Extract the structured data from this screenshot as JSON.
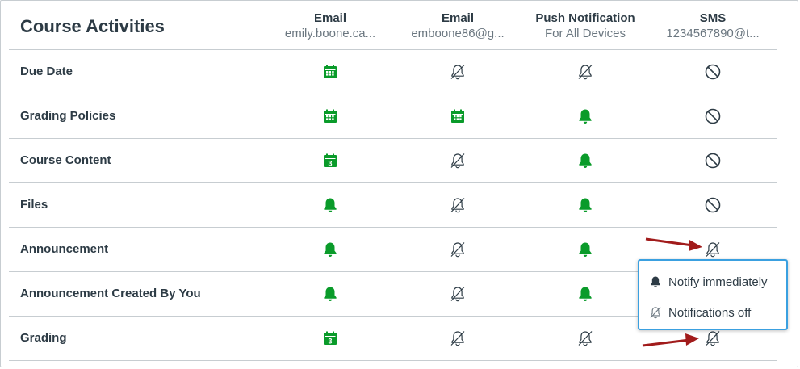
{
  "page": {
    "title": "Course Activities"
  },
  "columns": [
    {
      "title": "Email",
      "subtitle": "emily.boone.ca..."
    },
    {
      "title": "Email",
      "subtitle": "emboone86@g..."
    },
    {
      "title": "Push Notification",
      "subtitle": "For All Devices"
    },
    {
      "title": "SMS",
      "subtitle": "1234567890@t..."
    }
  ],
  "rows": [
    {
      "label": "Due Date",
      "cells": [
        "calendar-weekly-icon",
        "bell-off-icon",
        "bell-off-icon",
        "disabled-icon"
      ]
    },
    {
      "label": "Grading Policies",
      "cells": [
        "calendar-weekly-icon",
        "calendar-weekly-icon",
        "bell-icon",
        "disabled-icon"
      ]
    },
    {
      "label": "Course Content",
      "cells": [
        "calendar-daily-icon",
        "bell-off-icon",
        "bell-icon",
        "disabled-icon"
      ]
    },
    {
      "label": "Files",
      "cells": [
        "bell-icon",
        "bell-off-icon",
        "bell-icon",
        "disabled-icon"
      ]
    },
    {
      "label": "Announcement",
      "cells": [
        "bell-icon",
        "bell-off-icon",
        "bell-icon",
        "bell-off-icon"
      ]
    },
    {
      "label": "Announcement Created By You",
      "cells": [
        "bell-icon",
        "bell-off-icon",
        "bell-icon",
        "hidden"
      ]
    },
    {
      "label": "Grading",
      "cells": [
        "calendar-daily-icon",
        "bell-off-icon",
        "bell-off-icon",
        "bell-off-icon"
      ]
    }
  ],
  "calendar_day_number": "3",
  "popup_menu": {
    "items": [
      {
        "label": "Notify immediately",
        "icon": "bell-icon"
      },
      {
        "label": "Notifications off",
        "icon": "bell-off-icon"
      }
    ]
  },
  "colors": {
    "accent_green": "#0a9b2a",
    "icon_gray": "#2d3b45",
    "popup_border": "#3aa0e0",
    "arrow": "#a11b1b"
  }
}
